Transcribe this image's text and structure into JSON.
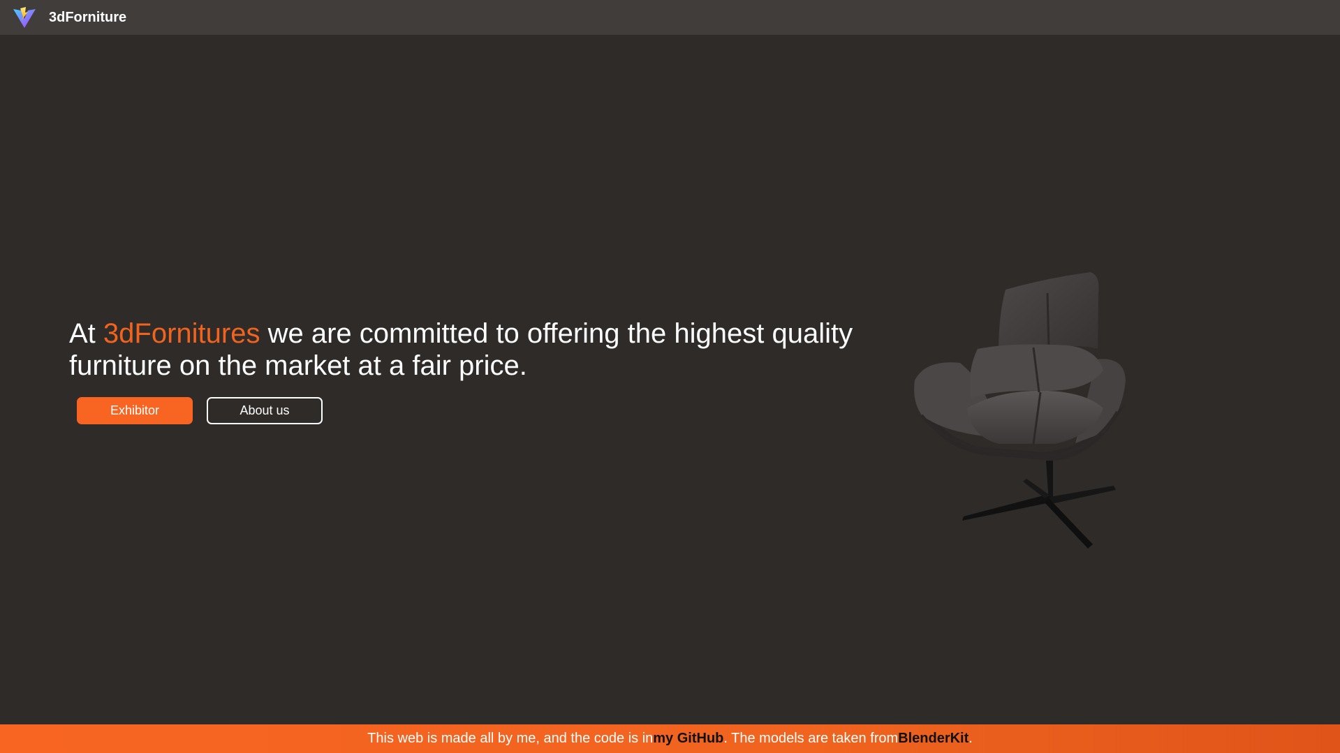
{
  "navbar": {
    "logo_icon": "vite-logo-icon",
    "brand": "3dForniture"
  },
  "hero": {
    "headline_prefix": "At ",
    "headline_brand": "3dFornitures",
    "headline_line1_rest": " we are committed to offering the highest quality",
    "headline_line2": "furniture on the market at a fair price.",
    "exhibitor_label": "Exhibitor",
    "about_label": "About us",
    "image_icon": "armchair-3d-model"
  },
  "footer": {
    "text_before_github": "This web is made all by me, and the code is in ",
    "github_link": "my GitHub",
    "text_between": ". The models are taken from ",
    "blenderkit_link": "BlenderKit",
    "text_after": "."
  },
  "colors": {
    "background": "#2f2b28",
    "navbar": "#403d3b",
    "accent": "#f86522",
    "accent_text": "#f0641f"
  }
}
